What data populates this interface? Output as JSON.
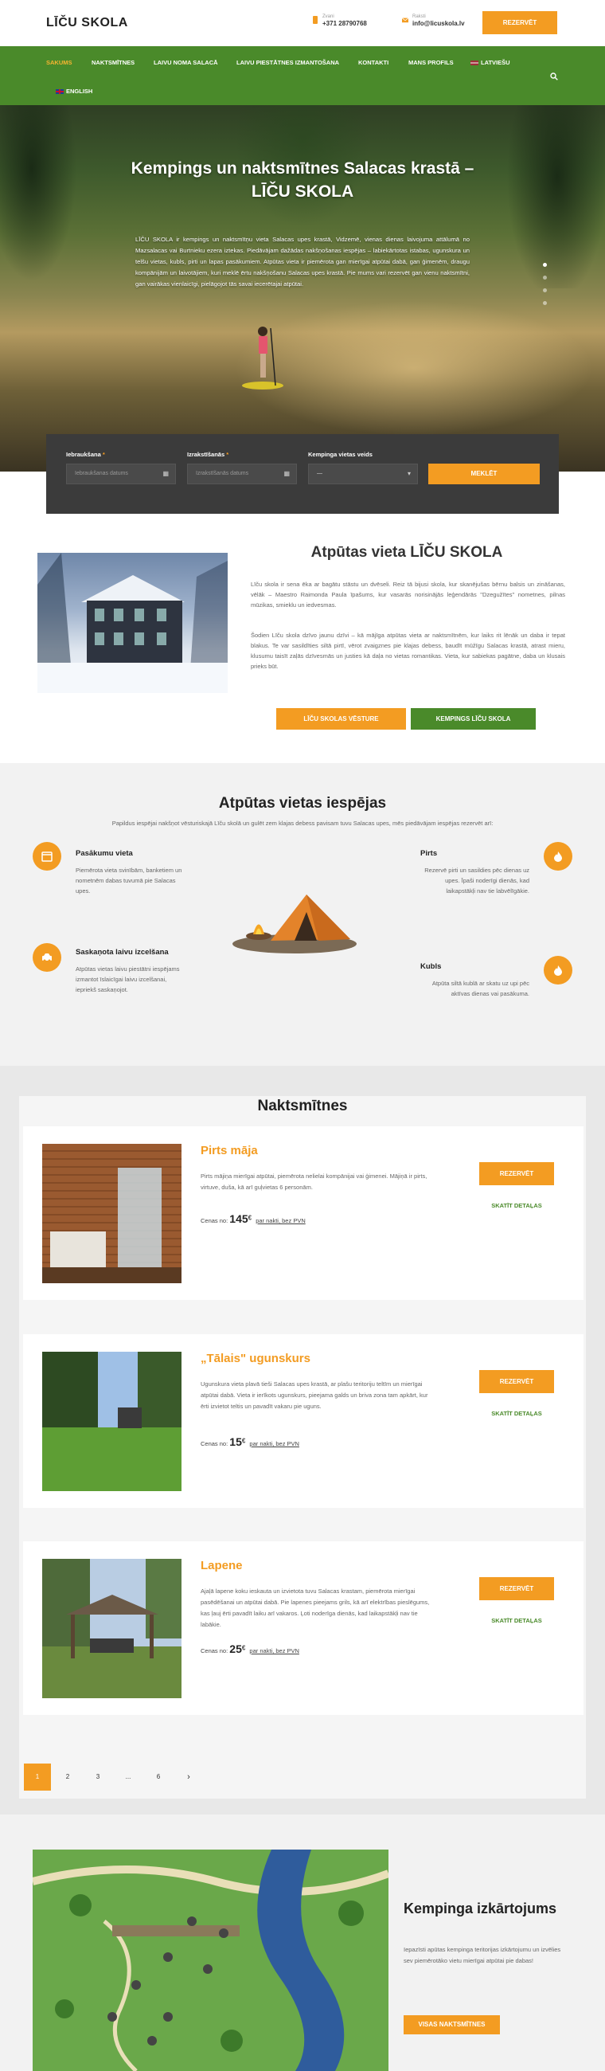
{
  "header": {
    "logo": "LĪČU SKOLA",
    "phone_label": "Zvani",
    "phone": "+371 28790768",
    "email_label": "Raksti",
    "email": "info@licuskola.lv",
    "reserve_label": "REZERVĒT"
  },
  "nav": {
    "items": [
      "SAKUMS",
      "NAKTSMĪTNES",
      "LAIVU NOMA SALACĀ",
      "LAIVU PIESTĀTNES IZMANTOŠANA",
      "KONTAKTI",
      "MANS PROFILS"
    ],
    "lang_lv": "LATVIEŠU",
    "lang_en": "ENGLISH"
  },
  "hero": {
    "title": "Kempings un naktsmītnes Salacas krastā – LĪČU SKOLA",
    "text": "LĪČU SKOLA ir kempings un naktsmītņu vieta Salacas upes krastā, Vidzemē, vienas dienas laivojuma attālumā no Mazsalacas vai Burtnieku ezera iztekas. Piedāvājam dažādas nakšņošanas iespējas – labiekārtotas istabas, ugunskura un telšu vietas, kubls, pirti un lapas pasākumiem. Atpūtas vieta ir piemērota gan mierīgai atpūtai dabā, gan ģimenēm, draugu kompānijām un laivotājiem, kuri meklē ērtu nakšņošanu Salacas upes krastā. Pie mums vari rezervēt gan vienu naktsmītni, gan vairākas vienlaicīgi, pielāgojot tās savai iecerētajai atpūtai."
  },
  "search": {
    "checkin_label": "Iebraukšana",
    "checkin_placeholder": "Iebraukšanas datums",
    "checkout_label": "Izrakstīšanās",
    "checkout_placeholder": "Izrakstīšanās datums",
    "type_label": "Kempinga vietas veids",
    "type_value": "—",
    "button": "MEKLĒT",
    "required_mark": "*"
  },
  "about": {
    "title": "Atpūtas vieta LĪČU SKOLA",
    "p1": "Līču skola ir sena ēka ar bagātu stāstu un dvēseli. Reiz tā bijusi skola, kur skanējušas bērnu balsis un zināšanas, vēlāk – Maestro Raimonda Paula īpašums, kur vasarās norisinājās leģendārās \"Dzegužītes\" nometnes, pilnas mūzikas, smieklu un iedvesmas.",
    "p2": "Šodien Līču skola dzīvo jaunu dzīvi – kā mājīga atpūtas vieta ar naktsmītnēm, kur laiks rit lēnāk un daba ir tepat blakus. Te var sasildīties siltā pirtī, vērot zvaigznes pie klajas debess, baudīt mūžīgu Salacas krastā, atrast mieru, klusumu taisīt zaļās dzīvesmās un justies kā daļa no vietas romantikas. Vieta, kur sabiekas pagātne, daba un klusais prieks būt.",
    "btn_history": "LĪČU SKOLAS VĒSTURE",
    "btn_camping": "KEMPINGS LĪČU SKOLA"
  },
  "features": {
    "title": "Atpūtas vietas iespējas",
    "subtitle": "Papildus iespējai nakšņot vēsturiskajā Līču skolā un gulēt zem klajas debess pavisam tuvu Salacas upes, mēs piedāvājam iespējas rezervēt arī:",
    "items": [
      {
        "title": "Pasākumu vieta",
        "desc": "Piemērota vieta svinībām, banketiem un nometnēm dabas tuvumā pie Salacas upes.",
        "icon": "calendar-icon"
      },
      {
        "title": "Saskaņota laivu izcelšana",
        "desc": "Atpūtas vietas laivu piestātni iespējams izmantot īslaicīgai laivu izcelšanai, iepriekš saskaņojot.",
        "icon": "car-icon"
      },
      {
        "title": "Pirts",
        "desc": "Rezervē pirti un sasildies pēc dienas uz upes. Īpaši noderīgi dienās, kad laikapstākļi nav tie labvēlīgākie.",
        "icon": "flame-icon"
      },
      {
        "title": "Kubls",
        "desc": "Atpūta siltā kublā ar skatu uz upi pēc aktīvas dienas vai pasākuma.",
        "icon": "flame-icon"
      }
    ]
  },
  "accommodation": {
    "title": "Naktsmītnes",
    "price_prefix": "Cenas no:",
    "per_night": "par nakti, bez PVN",
    "reserve": "REZERVĒT",
    "details": "SKATĪT DETAĻAS",
    "currency": "€",
    "cards": [
      {
        "title": "Pirts māja",
        "desc": "Pirts mājiņa mierīgai atpūtai, piemērota nelielai kompānijai vai ģimenei. Mājiņā ir pirts, virtuve, duša, kā arī guļvietas 6 personām.",
        "price": "145"
      },
      {
        "title": "„Tālais\" ugunskurs",
        "desc": "Ugunskura vieta plavā tieši Salacas upes krastā, ar plašu teritoriju teltīm un mierīgai atpūtai dabā. Vieta ir ierīkots ugunskurs, pieejama galds un briva zona tam apkārt, kur ērti izvietot teltis un pavadīt vakaru pie uguns.",
        "price": "15"
      },
      {
        "title": "Lapene",
        "desc": "Ajaļā lapene koku ieskauta un izvietota tuvu Salacas krastam, piemērota mierīgai pasēdēšanai un atpūtai dabā. Pie lapenes pieejams grils, kā arī elektrības pieslēgums, kas ļauj ērti pavadīt laiku arī vakaros. Ļoti noderīga dienās, kad laikapstākļi nav tie labākie.",
        "price": "25"
      }
    ]
  },
  "pagination": [
    "1",
    "2",
    "3",
    "...",
    "6"
  ],
  "map": {
    "title": "Kempinga izkārtojums",
    "desc": "Iepazīsti apūtas kempinga teritorijas izkārtojumu un izvēlies sev piemērotāko vietu mierīgai atpūtai pie dabas!",
    "button": "VISAS NAKTSMĪTNES"
  },
  "colors": {
    "accent": "#f39c22",
    "brand_green": "#4a8a2a",
    "dark": "#3b3b3b"
  }
}
